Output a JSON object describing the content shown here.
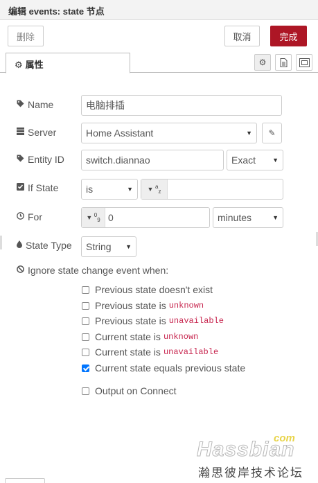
{
  "tray": {
    "title": "编辑 events: state 节点"
  },
  "toolbar": {
    "delete_label": "删除",
    "cancel_label": "取消",
    "done_label": "完成"
  },
  "tabs": [
    {
      "label": "属性",
      "icon": "gear-icon"
    }
  ],
  "tab_icons": [
    "gear-icon",
    "document-icon",
    "layout-icon"
  ],
  "form": {
    "name": {
      "label": "Name",
      "value": "电脑排插",
      "icon": "tag-icon"
    },
    "server": {
      "label": "Server",
      "value": "Home Assistant",
      "icon": "server-icon",
      "edit_icon": "pencil-icon"
    },
    "entity_id": {
      "label": "Entity ID",
      "value": "switch.diannao",
      "match": "Exact",
      "icon": "tag-icon"
    },
    "if_state": {
      "label": "If State",
      "operator": "is",
      "type_icon": "string-az-icon",
      "value": "",
      "icon": "checkbox-icon"
    },
    "for": {
      "label": "For",
      "type_icon": "number-09-icon",
      "value": "0",
      "unit": "minutes",
      "icon": "clock-icon"
    },
    "state_type": {
      "label": "State Type",
      "value": "String",
      "icon": "tint-icon"
    },
    "ignore": {
      "label": "Ignore state change event when:",
      "icon": "ban-icon",
      "options": [
        {
          "text": "Previous state doesn't exist",
          "code": "",
          "checked": false
        },
        {
          "text": "Previous state is",
          "code": "unknown",
          "checked": false
        },
        {
          "text": "Previous state is",
          "code": "unavailable",
          "checked": false
        },
        {
          "text": "Current state is",
          "code": "unknown",
          "checked": false
        },
        {
          "text": "Current state is",
          "code": "unavailable",
          "checked": false
        },
        {
          "text": "Current state equals previous state",
          "code": "",
          "checked": true
        }
      ]
    },
    "output_on_connect": {
      "label": "Output on Connect",
      "checked": false
    }
  },
  "watermark": {
    "com": "com",
    "main": "Hassbian",
    "sub": "瀚思彼岸技术论坛"
  }
}
